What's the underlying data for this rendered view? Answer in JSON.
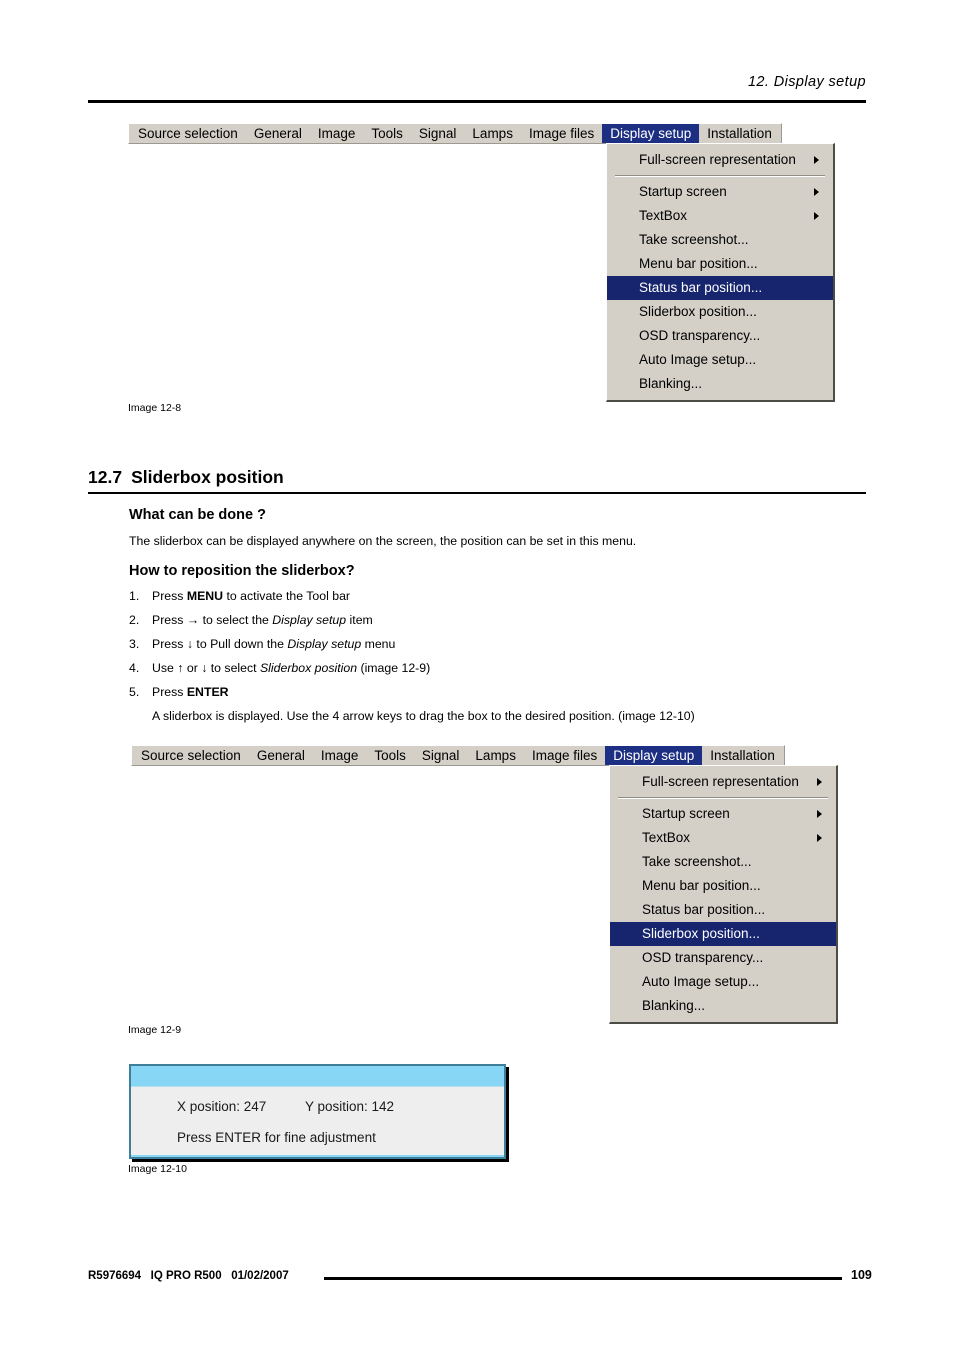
{
  "header": {
    "running_title": "12.  Display setup"
  },
  "menu_bar_items": [
    "Source selection",
    "General",
    "Image",
    "Tools",
    "Signal",
    "Lamps",
    "Image files",
    "Display setup",
    "Installation"
  ],
  "dropdown_items": [
    "Full-screen representation",
    "Startup screen",
    "TextBox",
    "Take screenshot...",
    "Menu bar position...",
    "Status bar position...",
    "Sliderbox position...",
    "OSD transparency...",
    "Auto Image setup...",
    "Blanking..."
  ],
  "figure1": {
    "caption": "Image 12-8",
    "selected_menu": "Display setup",
    "highlighted_item": "Status bar position..."
  },
  "figure2": {
    "caption": "Image 12-9",
    "selected_menu": "Display setup",
    "highlighted_item": "Sliderbox position..."
  },
  "section": {
    "number": "12.7",
    "title": "Sliderbox position"
  },
  "what_can_be_done": {
    "heading": "What can be done ?",
    "text": "The sliderbox can be displayed anywhere on the screen, the position can be set in this menu."
  },
  "how_to": {
    "heading": "How to reposition the sliderbox?",
    "steps": [
      {
        "num": "1.",
        "parts": [
          {
            "t": "Press ",
            "s": "n"
          },
          {
            "t": "MENU",
            "s": "b"
          },
          {
            "t": " to activate the Tool bar",
            "s": "n"
          }
        ]
      },
      {
        "num": "2.",
        "parts": [
          {
            "t": "Press → to select the ",
            "s": "n"
          },
          {
            "t": "Display setup",
            "s": "i"
          },
          {
            "t": " item",
            "s": "n"
          }
        ]
      },
      {
        "num": "3.",
        "parts": [
          {
            "t": "Press ↓ to Pull down the ",
            "s": "n"
          },
          {
            "t": "Display setup",
            "s": "i"
          },
          {
            "t": " menu",
            "s": "n"
          }
        ]
      },
      {
        "num": "4.",
        "parts": [
          {
            "t": "Use ↑ or ↓ to select ",
            "s": "n"
          },
          {
            "t": "Sliderbox position",
            "s": "i"
          },
          {
            "t": " (image 12-9)",
            "s": "n"
          }
        ]
      },
      {
        "num": "5.",
        "parts": [
          {
            "t": "Press ",
            "s": "n"
          },
          {
            "t": "ENTER",
            "s": "b"
          }
        ]
      }
    ],
    "note": "A sliderbox is displayed.  Use the 4 arrow keys to drag the box to the desired position.  (image 12-10)"
  },
  "sliderbox": {
    "x_label": "X position: 247",
    "y_label": "Y position: 142",
    "hint": "Press ENTER for fine adjustment",
    "caption": "Image 12-10",
    "border_color": "#3f7f99",
    "title_color": "#87d6f5",
    "body_color": "#eeeeee"
  },
  "footer": {
    "left": "R5976694   IQ PRO R500   01/02/2007",
    "page": "109"
  },
  "colors": {
    "menu_face": "#d4d0c8",
    "menu_selected": "#1d2f82",
    "dropdown_highlight": "#16256e"
  }
}
